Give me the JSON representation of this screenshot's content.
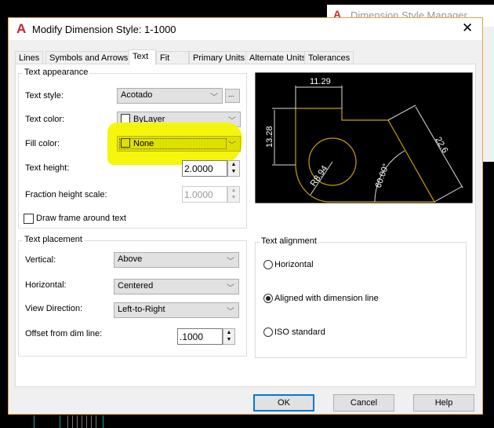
{
  "background_window": {
    "title": "Dimension Style Manager"
  },
  "dialog": {
    "title": "Modify Dimension Style: 1-1000",
    "close_icon": "close-icon",
    "accent": "#0078d7",
    "highlight_color": "#f5f500"
  },
  "tabs": [
    {
      "label": "Lines"
    },
    {
      "label": "Symbols and Arrows"
    },
    {
      "label": "Text",
      "active": true
    },
    {
      "label": "Fit"
    },
    {
      "label": "Primary Units"
    },
    {
      "label": "Alternate Units"
    },
    {
      "label": "Tolerances"
    }
  ],
  "text_appearance": {
    "title": "Text appearance",
    "text_style": {
      "label": "Text style:",
      "value": "Acotado",
      "browse": "..."
    },
    "text_color": {
      "label": "Text color:",
      "value": "ByLayer"
    },
    "fill_color": {
      "label": "Fill color:",
      "value": "None"
    },
    "text_height": {
      "label": "Text height:",
      "value": "2.0000"
    },
    "fraction_height_scale": {
      "label": "Fraction height scale:",
      "value": "1.0000"
    },
    "draw_frame": {
      "label": "Draw frame around text",
      "checked": false
    }
  },
  "preview": {
    "dims": {
      "top": "11.29",
      "left": "13.28",
      "right": "22.6",
      "angle": "60.00°",
      "radius": "R8.94"
    },
    "outline_color": "#c8a000"
  },
  "text_placement": {
    "title": "Text placement",
    "vertical": {
      "label": "Vertical:",
      "value": "Above"
    },
    "horizontal": {
      "label": "Horizontal:",
      "value": "Centered"
    },
    "view_direction": {
      "label": "View Direction:",
      "value": "Left-to-Right"
    },
    "offset": {
      "label": "Offset from dim line:",
      "value": ".1000"
    }
  },
  "text_alignment": {
    "title": "Text alignment",
    "options": [
      {
        "label": "Horizontal",
        "selected": false
      },
      {
        "label": "Aligned with dimension line",
        "selected": true
      },
      {
        "label": "ISO standard",
        "selected": false
      }
    ]
  },
  "buttons": {
    "ok": "OK",
    "cancel": "Cancel",
    "help": "Help"
  }
}
